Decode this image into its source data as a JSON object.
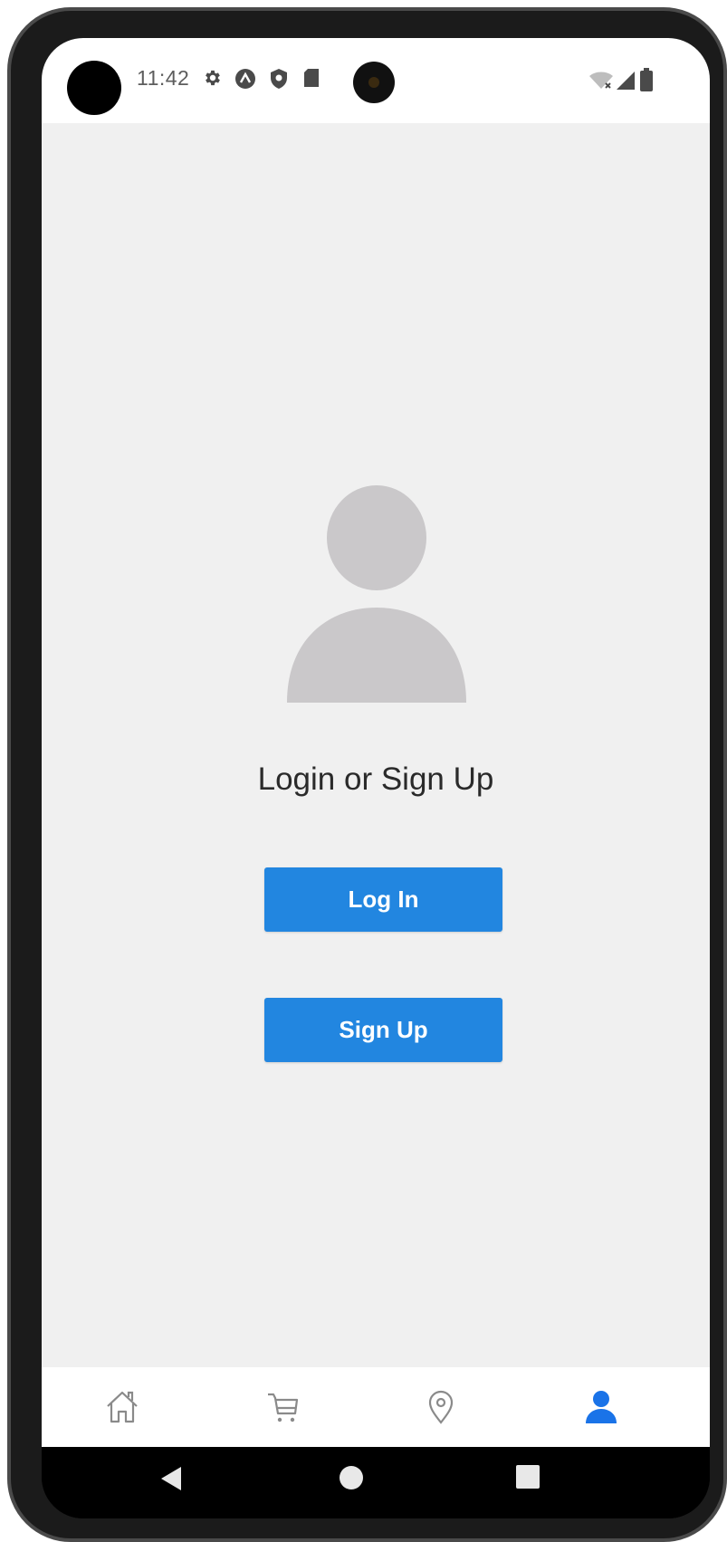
{
  "status_bar": {
    "time": "11:42",
    "icons": [
      "settings-icon",
      "app-notification-icon",
      "shield-icon",
      "sd-card-icon"
    ],
    "right_icons": [
      "wifi-icon",
      "signal-icon",
      "battery-icon"
    ]
  },
  "profile": {
    "heading": "Login or Sign Up",
    "login_label": "Log In",
    "signup_label": "Sign Up",
    "placeholder_icon": "user-placeholder-icon"
  },
  "tab_bar": {
    "tabs": [
      {
        "icon": "home-icon",
        "active": false
      },
      {
        "icon": "cart-icon",
        "active": false
      },
      {
        "icon": "location-pin-icon",
        "active": false
      },
      {
        "icon": "person-icon",
        "active": true
      }
    ],
    "active_color": "#1a73e8",
    "inactive_color": "#8a8a8a"
  },
  "nav_bar": {
    "buttons": [
      "back-icon",
      "home-circle-icon",
      "recents-icon"
    ]
  },
  "colors": {
    "primary_button": "#2286e0",
    "background": "#f0f0f0",
    "placeholder": "#cac8ca"
  }
}
